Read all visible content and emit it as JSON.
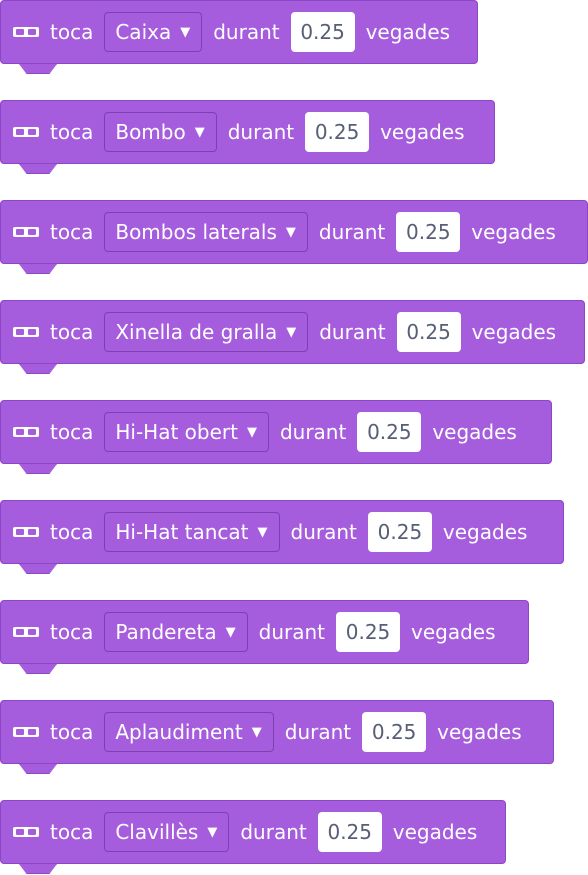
{
  "colors": {
    "block_fill": "#a65ddd",
    "block_border": "#8d46c5",
    "input_text": "#575e75"
  },
  "blocks": [
    {
      "play": "toca",
      "drum": "Caixa",
      "during": "durant",
      "value": "0.25",
      "unit": "vegades",
      "icon": "drum-icon"
    },
    {
      "play": "toca",
      "drum": "Bombo",
      "during": "durant",
      "value": "0.25",
      "unit": "vegades",
      "icon": "drum-icon"
    },
    {
      "play": "toca",
      "drum": "Bombos laterals",
      "during": "durant",
      "value": "0.25",
      "unit": "vegades",
      "icon": "drum-icon"
    },
    {
      "play": "toca",
      "drum": "Xinella de gralla",
      "during": "durant",
      "value": "0.25",
      "unit": "vegades",
      "icon": "drum-icon"
    },
    {
      "play": "toca",
      "drum": "Hi-Hat obert",
      "during": "durant",
      "value": "0.25",
      "unit": "vegades",
      "icon": "drum-icon"
    },
    {
      "play": "toca",
      "drum": "Hi-Hat tancat",
      "during": "durant",
      "value": "0.25",
      "unit": "vegades",
      "icon": "drum-icon"
    },
    {
      "play": "toca",
      "drum": "Pandereta",
      "during": "durant",
      "value": "0.25",
      "unit": "vegades",
      "icon": "drum-icon"
    },
    {
      "play": "toca",
      "drum": "Aplaudiment",
      "during": "durant",
      "value": "0.25",
      "unit": "vegades",
      "icon": "drum-icon"
    },
    {
      "play": "toca",
      "drum": "Clavillès",
      "during": "durant",
      "value": "0.25",
      "unit": "vegades",
      "icon": "drum-icon"
    }
  ]
}
